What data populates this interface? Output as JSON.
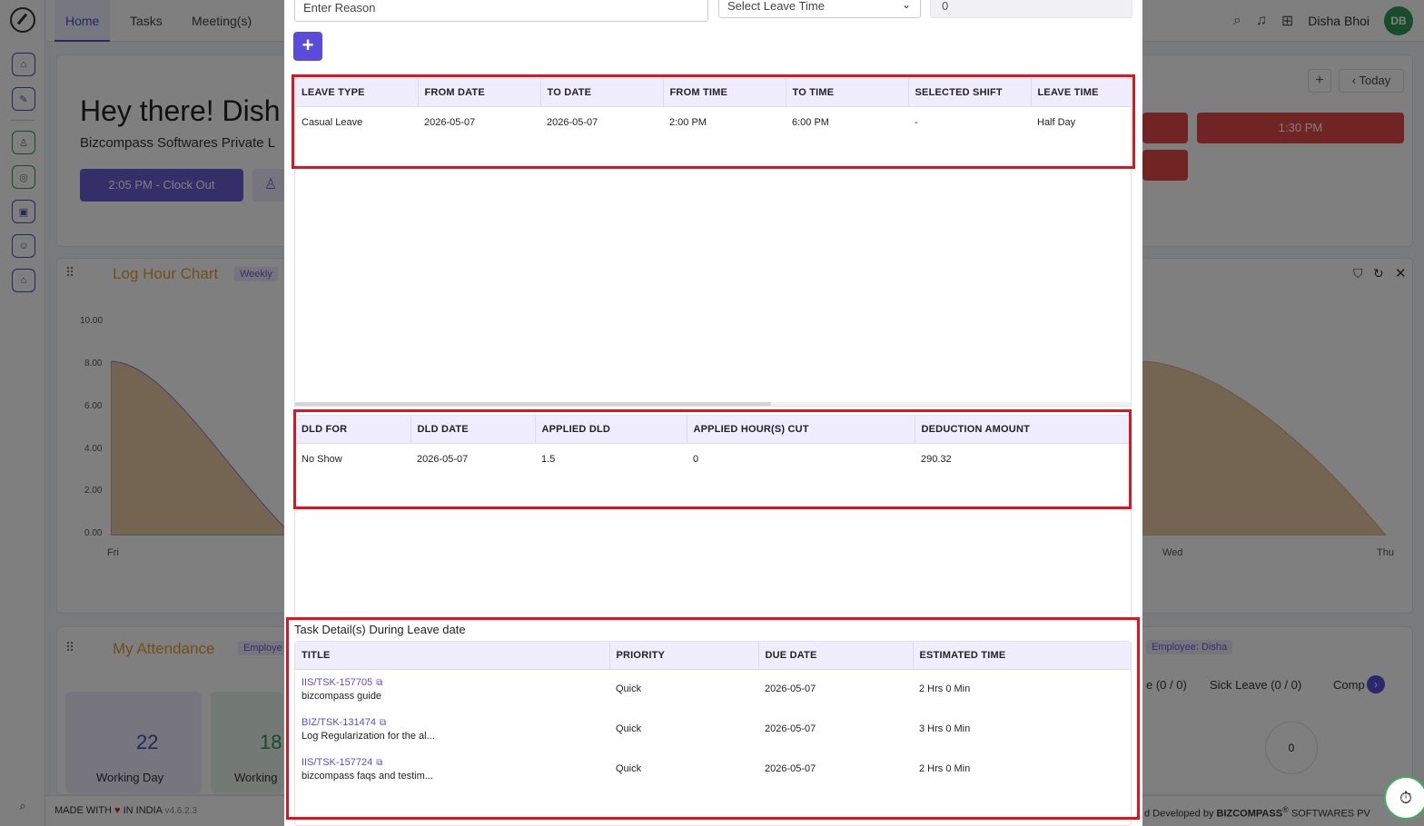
{
  "topbar": {
    "tabs": [
      {
        "label": "Home"
      },
      {
        "label": "Tasks"
      },
      {
        "label": "Meeting(s)"
      }
    ],
    "user_name": "Disha Bhoi",
    "avatar_initials": "DB"
  },
  "dashboard": {
    "greeting": "Hey there! Dish",
    "company": "Bizcompass Softwares Private L",
    "clock_out_label": "2:05 PM - Clock Out",
    "today_label": "Today",
    "chip_time": "1:30 PM",
    "log_hour": {
      "title": "Log Hour Chart",
      "badge": "Weekly",
      "y_ticks": [
        "10.00",
        "8.00",
        "6.00",
        "4.00",
        "2.00",
        "0.00"
      ],
      "x_ticks": [
        "Fri",
        "Wed",
        "Thu"
      ]
    },
    "attendance": {
      "title": "My Attendance",
      "badge": "Employe",
      "badge_right": "Employee: Disha",
      "working_day_value": "22",
      "working_day_label": "Working Day",
      "working_value2": "18",
      "working_label2": "Working",
      "leave_chips": [
        "e (0 / 0)",
        "Sick Leave (0 / 0)",
        "Comp"
      ],
      "ring_value": "0"
    },
    "footer_left": "MADE WITH",
    "footer_left2": "IN INDIA",
    "version": "v4.6.2.3",
    "footer_right": "d Developed by",
    "footer_brand": "BIZCOMPASS",
    "footer_brand2": "SOFTWARES PV"
  },
  "modal": {
    "reason_placeholder": "Enter Reason",
    "leave_time_select": "Select Leave Time",
    "hours_value": "0",
    "leave_table": {
      "headers": [
        "LEAVE TYPE",
        "FROM DATE",
        "TO DATE",
        "FROM TIME",
        "TO TIME",
        "SELECTED SHIFT",
        "LEAVE TIME"
      ],
      "rows": [
        [
          "Casual Leave",
          "2026-05-07",
          "2026-05-07",
          "2:00 PM",
          "6:00 PM",
          "-",
          "Half Day"
        ]
      ]
    },
    "dld_table": {
      "headers": [
        "DLD FOR",
        "DLD DATE",
        "APPLIED DLD",
        "APPLIED HOUR(S) CUT",
        "DEDUCTION AMOUNT"
      ],
      "rows": [
        [
          "No Show",
          "2026-05-07",
          "1.5",
          "0",
          "290.32"
        ]
      ]
    },
    "task_caption": "Task Detail(s) During Leave date",
    "task_table": {
      "headers": [
        "TITLE",
        "PRIORITY",
        "DUE DATE",
        "ESTIMATED TIME"
      ],
      "rows": [
        {
          "id": "IIS/TSK-157705",
          "title": "bizcompass guide",
          "priority": "Quick",
          "due": "2026-05-07",
          "est": "2 Hrs 0 Min"
        },
        {
          "id": "BIZ/TSK-131474",
          "title": "Log Regularization for the al...",
          "priority": "Quick",
          "due": "2026-05-07",
          "est": "3 Hrs 0 Min"
        },
        {
          "id": "IIS/TSK-157724",
          "title": "bizcompass faqs and testim...",
          "priority": "Quick",
          "due": "2026-05-07",
          "est": "2 Hrs 0 Min"
        }
      ]
    }
  },
  "colors": {
    "accent": "#5b4bdb",
    "highlight": "#e0141e",
    "header_bg": "#efedff",
    "danger": "#e04848"
  }
}
